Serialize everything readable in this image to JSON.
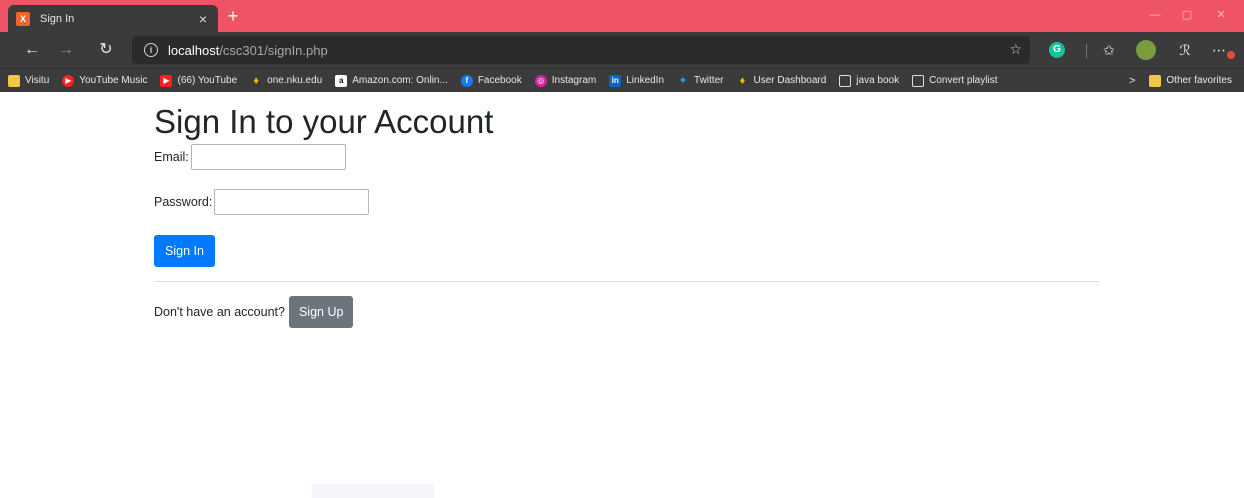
{
  "browser": {
    "tab_title": "Sign In",
    "tab_favicon_text": "X",
    "tab_close": "×",
    "new_tab": "+",
    "win_min": "—",
    "win_max": "▢",
    "win_close": "✕",
    "address_host": "localhost",
    "address_path": "/csc301/signIn.php",
    "grammarly_text": "G",
    "accent_color": "#ee5465"
  },
  "bookmarks": [
    {
      "label": "Visitu",
      "icon": "folder-icon",
      "color": "#f2c744"
    },
    {
      "label": "YouTube Music",
      "icon": "youtube-music-icon",
      "color": "#ff1f1f"
    },
    {
      "label": "(66) YouTube",
      "icon": "youtube-icon",
      "color": "#ff1f1f"
    },
    {
      "label": "one.nku.edu",
      "icon": "nku-icon",
      "color": "#f5b301"
    },
    {
      "label": "Amazon.com: Onlin...",
      "icon": "amazon-icon",
      "color": "#ffffff"
    },
    {
      "label": "Facebook",
      "icon": "facebook-icon",
      "color": "#1877f2"
    },
    {
      "label": "Instagram",
      "icon": "instagram-icon",
      "color": "#d6249f"
    },
    {
      "label": "LinkedIn",
      "icon": "linkedin-icon",
      "color": "#0a66c2"
    },
    {
      "label": "Twitter",
      "icon": "twitter-icon",
      "color": "#1da1f2"
    },
    {
      "label": "User Dashboard",
      "icon": "nku-icon",
      "color": "#f5b301"
    },
    {
      "label": "java book",
      "icon": "page-icon",
      "color": "#3b3b3b"
    },
    {
      "label": "Convert playlist",
      "icon": "page-icon",
      "color": "#3b3b3b"
    }
  ],
  "bookmarks_overflow": "Other favorites",
  "page": {
    "heading": "Sign In to your Account",
    "email_label": "Email:",
    "password_label": "Password:",
    "sign_in_button": "Sign In",
    "signup_prompt": "Don't have an account?",
    "sign_up_button": "Sign Up"
  }
}
